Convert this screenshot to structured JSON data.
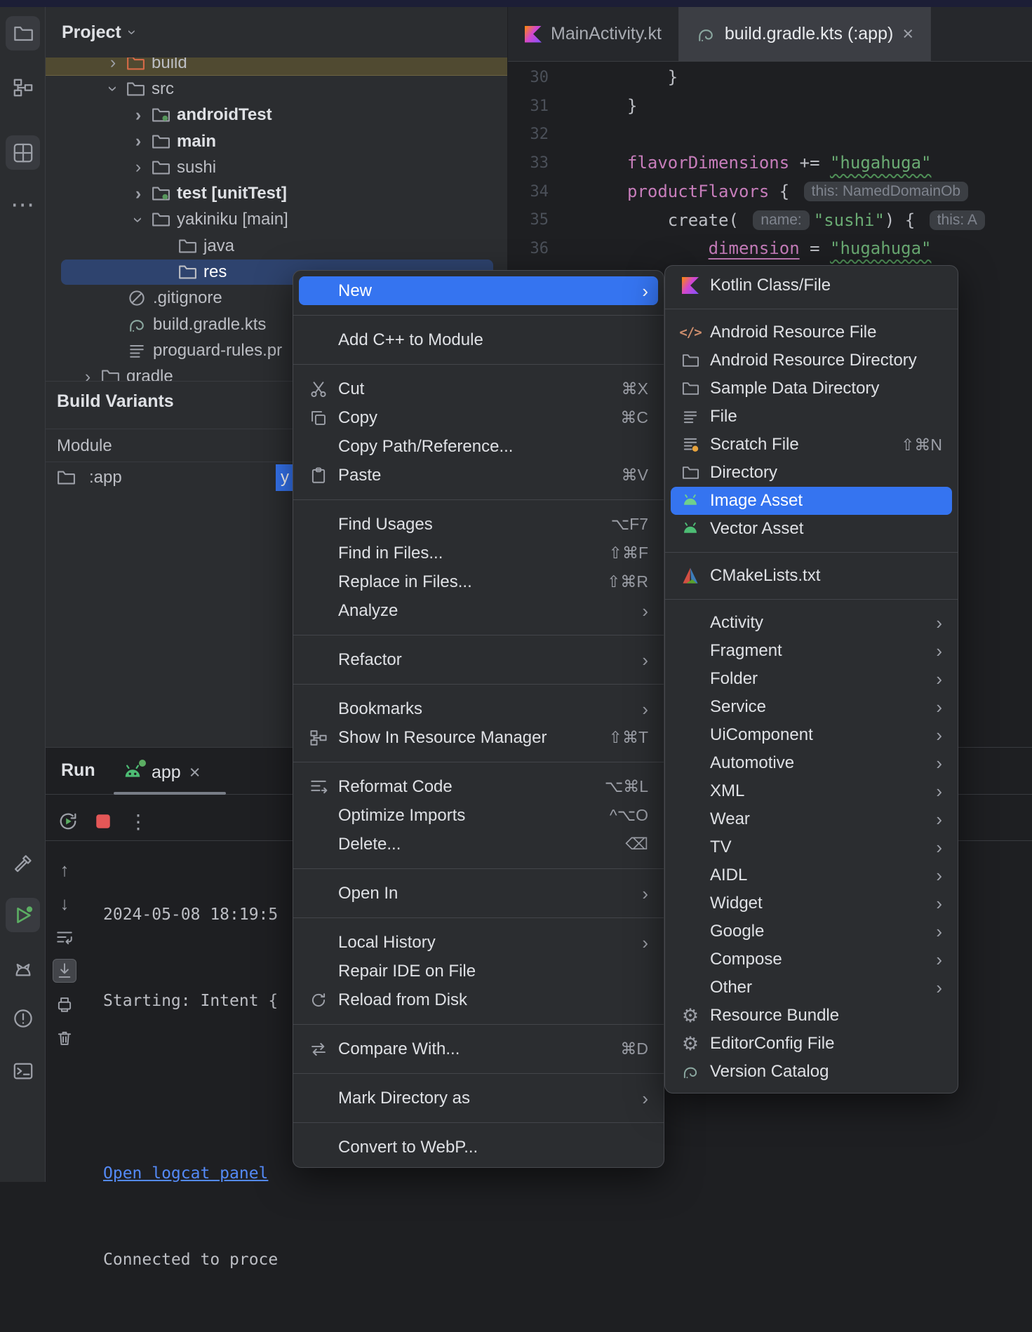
{
  "colors": {
    "accent_blue": "#3574f0",
    "selection_blue": "#2e436e",
    "panel_bg": "#2b2d30",
    "editor_bg": "#1e1f22",
    "string_green": "#6aab73",
    "function_purple": "#c77dbb",
    "link_blue": "#548af7",
    "android_green": "#4dbd74",
    "stop_red": "#e45757"
  },
  "left_rail": {
    "top": [
      {
        "name": "project",
        "icon": "folder-icon",
        "active": true
      },
      {
        "name": "structure",
        "icon": "structure-icon",
        "active": false
      },
      {
        "name": "resource-manager",
        "icon": "resource-manager-icon",
        "active": true
      },
      {
        "name": "more-tool-windows",
        "icon": "ellipsis-icon",
        "label": "⋯"
      }
    ],
    "bottom": [
      {
        "name": "build",
        "icon": "hammer-icon"
      },
      {
        "name": "run",
        "icon": "play-icon",
        "active": true,
        "badge": "green"
      },
      {
        "name": "logcat",
        "icon": "cat-icon"
      },
      {
        "name": "problems",
        "icon": "error-icon"
      },
      {
        "name": "terminal",
        "icon": "terminal-icon"
      }
    ]
  },
  "project_panel": {
    "title": "Project",
    "tree": [
      {
        "label": "build",
        "level": 2,
        "chevron": "collapsed",
        "icon": "folder-excluded",
        "row": "olive"
      },
      {
        "label": "src",
        "level": 2,
        "chevron": "expanded",
        "icon": "folder"
      },
      {
        "label": "androidTest",
        "level": 3,
        "chevron": "collapsed",
        "icon": "folder-test",
        "bold": true
      },
      {
        "label": "main",
        "level": 3,
        "chevron": "collapsed",
        "icon": "folder",
        "bold": true
      },
      {
        "label": "sushi",
        "level": 3,
        "chevron": "collapsed",
        "icon": "folder"
      },
      {
        "label": "test [unitTest]",
        "level": 3,
        "chevron": "collapsed",
        "icon": "folder-test",
        "bold": true
      },
      {
        "label": "yakiniku [main]",
        "level": 3,
        "chevron": "expanded",
        "icon": "folder"
      },
      {
        "label": "java",
        "level": 5,
        "icon": "folder"
      },
      {
        "label": "res",
        "level": 5,
        "icon": "folder",
        "selected": true
      },
      {
        "label": ".gitignore",
        "level": 3,
        "icon": "ignored-file"
      },
      {
        "label": "build.gradle.kts",
        "level": 3,
        "icon": "gradle-file"
      },
      {
        "label": "proguard-rules.pr",
        "level": 3,
        "icon": "text-file"
      },
      {
        "label": "gradle",
        "level": 1,
        "chevron": "collapsed",
        "icon": "folder"
      }
    ]
  },
  "build_variants": {
    "title": "Build Variants",
    "columns": [
      "Module"
    ],
    "rows": [
      {
        "module": ":app",
        "variant_visible": "y"
      }
    ]
  },
  "run_panel": {
    "title": "Run",
    "tab": {
      "label": "app",
      "icon": "android-icon",
      "close": "×"
    },
    "toolbar": [
      {
        "name": "rerun",
        "icon": "rerun-icon"
      },
      {
        "name": "stop",
        "icon": "stop-icon"
      },
      {
        "name": "more",
        "icon": "more-icon",
        "label": "⋮"
      }
    ],
    "gutter": [
      {
        "name": "up",
        "label": "↑"
      },
      {
        "name": "down",
        "label": "↓"
      },
      {
        "name": "soft-wrap",
        "icon": "soft-wrap-icon"
      },
      {
        "name": "scroll-to-end",
        "icon": "scroll-end-icon",
        "selected": true
      },
      {
        "name": "print",
        "icon": "print-icon"
      },
      {
        "name": "clear",
        "icon": "trash-icon"
      }
    ],
    "console": [
      {
        "text": "2024-05-08 18:19:5"
      },
      {
        "text": "Starting: Intent {"
      },
      {
        "text": ""
      },
      {
        "text": "Open logcat panel",
        "link": true
      },
      {
        "text": "Connected to proce"
      }
    ]
  },
  "editor": {
    "tabs": [
      {
        "label": "MainActivity.kt",
        "icon": "kotlin-icon",
        "active": false
      },
      {
        "label": "build.gradle.kts (:app)",
        "icon": "gradle-icon",
        "active": true,
        "close": "×"
      }
    ],
    "lines": [
      {
        "num": "30",
        "code": [
          {
            "t": "    }"
          }
        ]
      },
      {
        "num": "31",
        "code": [
          {
            "t": "}"
          }
        ]
      },
      {
        "num": "32",
        "code": []
      },
      {
        "num": "33",
        "code": [
          {
            "t": "flavorDimensions"
          },
          {
            "t": " += "
          },
          {
            "t": "\"hugahuga\""
          }
        ]
      },
      {
        "num": "34",
        "code": [
          {
            "t": "productFlavors"
          },
          {
            "t": " { "
          },
          {
            "t": "this: NamedDomainOb"
          }
        ]
      },
      {
        "num": "35",
        "code": [
          {
            "t": "    create( "
          },
          {
            "t": "name:"
          },
          {
            "t": "\"sushi\""
          },
          {
            "t": ") { "
          },
          {
            "t": "this: A"
          }
        ]
      },
      {
        "num": "36",
        "code": [
          {
            "t": "        "
          },
          {
            "t": "dimension"
          },
          {
            "t": " = "
          },
          {
            "t": "\"hugahuga\""
          }
        ]
      }
    ]
  },
  "context_menu": {
    "items": [
      {
        "label": "New",
        "arrow": true,
        "highlighted": true
      },
      {
        "type": "sep"
      },
      {
        "label": "Add C++ to Module"
      },
      {
        "type": "sep"
      },
      {
        "label": "Cut",
        "shortcut": "⌘X",
        "icon": "scissors-icon"
      },
      {
        "label": "Copy",
        "shortcut": "⌘C",
        "icon": "copy-icon"
      },
      {
        "label": "Copy Path/Reference..."
      },
      {
        "label": "Paste",
        "shortcut": "⌘V",
        "icon": "paste-icon"
      },
      {
        "type": "sep"
      },
      {
        "label": "Find Usages",
        "shortcut": "⌥F7"
      },
      {
        "label": "Find in Files...",
        "shortcut": "⇧⌘F"
      },
      {
        "label": "Replace in Files...",
        "shortcut": "⇧⌘R"
      },
      {
        "label": "Analyze",
        "arrow": true
      },
      {
        "type": "sep"
      },
      {
        "label": "Refactor",
        "arrow": true
      },
      {
        "type": "sep"
      },
      {
        "label": "Bookmarks",
        "arrow": true
      },
      {
        "label": "Show In Resource Manager",
        "shortcut": "⇧⌘T",
        "icon": "resource-manager-icon"
      },
      {
        "type": "sep"
      },
      {
        "label": "Reformat Code",
        "shortcut": "⌥⌘L",
        "icon": "reformat-icon"
      },
      {
        "label": "Optimize Imports",
        "shortcut": "^⌥O"
      },
      {
        "label": "Delete...",
        "shortcut": "⌫"
      },
      {
        "type": "sep"
      },
      {
        "label": "Open In",
        "arrow": true
      },
      {
        "type": "sep"
      },
      {
        "label": "Local History",
        "arrow": true
      },
      {
        "label": "Repair IDE on File"
      },
      {
        "label": "Reload from Disk",
        "icon": "reload-icon"
      },
      {
        "type": "sep"
      },
      {
        "label": "Compare With...",
        "shortcut": "⌘D",
        "icon": "compare-icon"
      },
      {
        "type": "sep"
      },
      {
        "label": "Mark Directory as",
        "arrow": true
      },
      {
        "type": "sep"
      },
      {
        "label": "Convert to WebP..."
      }
    ]
  },
  "new_submenu": {
    "items": [
      {
        "label": "Kotlin Class/File",
        "icon": "kotlin-icon"
      },
      {
        "type": "sep"
      },
      {
        "label": "Android Resource File",
        "icon": "code-file-icon"
      },
      {
        "label": "Android Resource Directory",
        "icon": "folder-icon"
      },
      {
        "label": "Sample Data Directory",
        "icon": "folder-icon"
      },
      {
        "label": "File",
        "icon": "text-file-icon"
      },
      {
        "label": "Scratch File",
        "shortcut": "⇧⌘N",
        "icon": "scratch-file-icon"
      },
      {
        "label": "Directory",
        "icon": "folder-icon"
      },
      {
        "label": "Image Asset",
        "icon": "android-icon",
        "highlighted": true
      },
      {
        "label": "Vector Asset",
        "icon": "android-icon"
      },
      {
        "type": "sep"
      },
      {
        "label": "CMakeLists.txt",
        "icon": "cmake-icon"
      },
      {
        "type": "sep"
      },
      {
        "label": "Activity",
        "arrow": true
      },
      {
        "label": "Fragment",
        "arrow": true
      },
      {
        "label": "Folder",
        "arrow": true
      },
      {
        "label": "Service",
        "arrow": true
      },
      {
        "label": "UiComponent",
        "arrow": true
      },
      {
        "label": "Automotive",
        "arrow": true
      },
      {
        "label": "XML",
        "arrow": true
      },
      {
        "label": "Wear",
        "arrow": true
      },
      {
        "label": "TV",
        "arrow": true
      },
      {
        "label": "AIDL",
        "arrow": true
      },
      {
        "label": "Widget",
        "arrow": true
      },
      {
        "label": "Google",
        "arrow": true
      },
      {
        "label": "Compose",
        "arrow": true
      },
      {
        "label": "Other",
        "arrow": true
      },
      {
        "label": "Resource Bundle",
        "icon": "gear-icon"
      },
      {
        "label": "EditorConfig File",
        "icon": "gear-icon"
      },
      {
        "label": "Version Catalog",
        "icon": "gradle-icon"
      }
    ]
  }
}
